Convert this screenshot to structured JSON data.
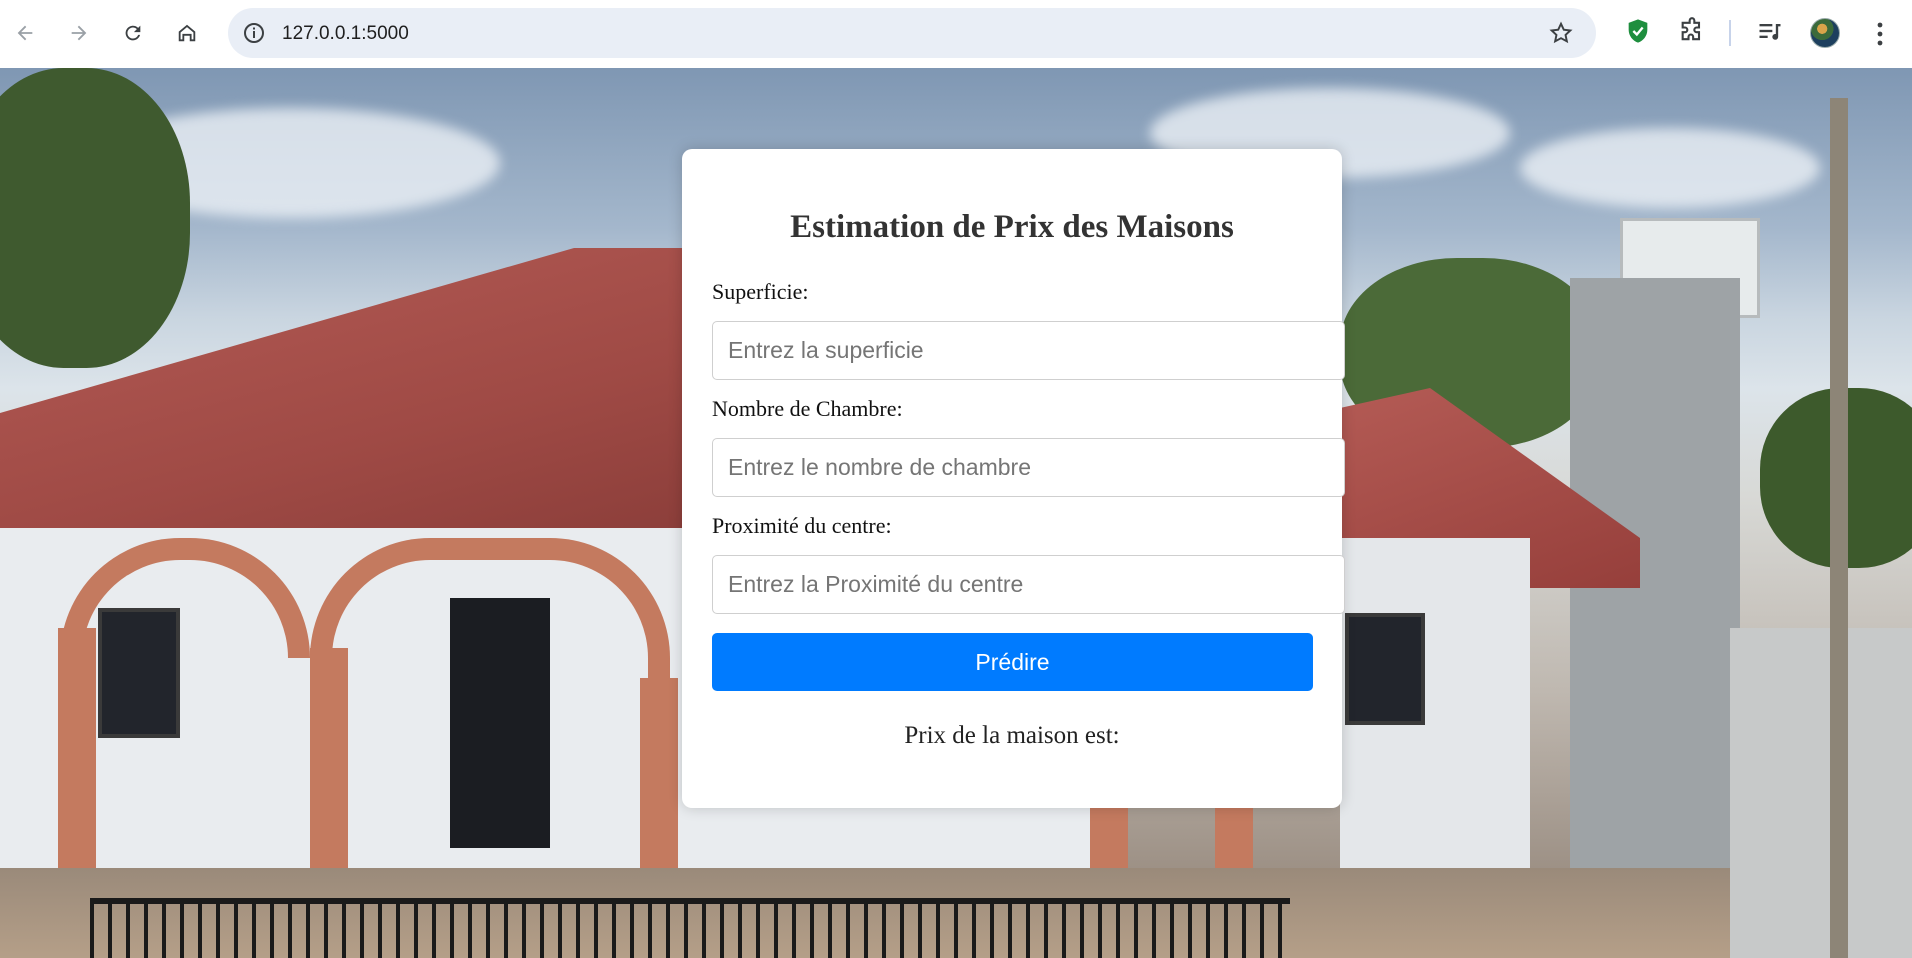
{
  "browser": {
    "url": "127.0.0.1:5000",
    "icons": [
      "back-icon",
      "forward-icon",
      "reload-icon",
      "home-icon",
      "site-info-icon",
      "bookmark-star-icon",
      "shield-extension-icon",
      "puzzle-extensions-icon",
      "media-control-icon",
      "profile-avatar",
      "menu-kebab-icon"
    ]
  },
  "form": {
    "title": "Estimation de Prix des Maisons",
    "superficie_label": "Superficie:",
    "superficie_placeholder": "Entrez la superficie",
    "chambre_label": "Nombre de Chambre:",
    "chambre_placeholder": "Entrez le nombre de chambre",
    "proximite_label": "Proximité du centre:",
    "proximite_placeholder": "Entrez la Proximité du centre",
    "submit_label": "Prédire",
    "result_text": "Prix de la maison est:"
  },
  "colors": {
    "button": "#007bff",
    "omnibox": "#e9eef6",
    "shield": "#1e8e3e"
  }
}
